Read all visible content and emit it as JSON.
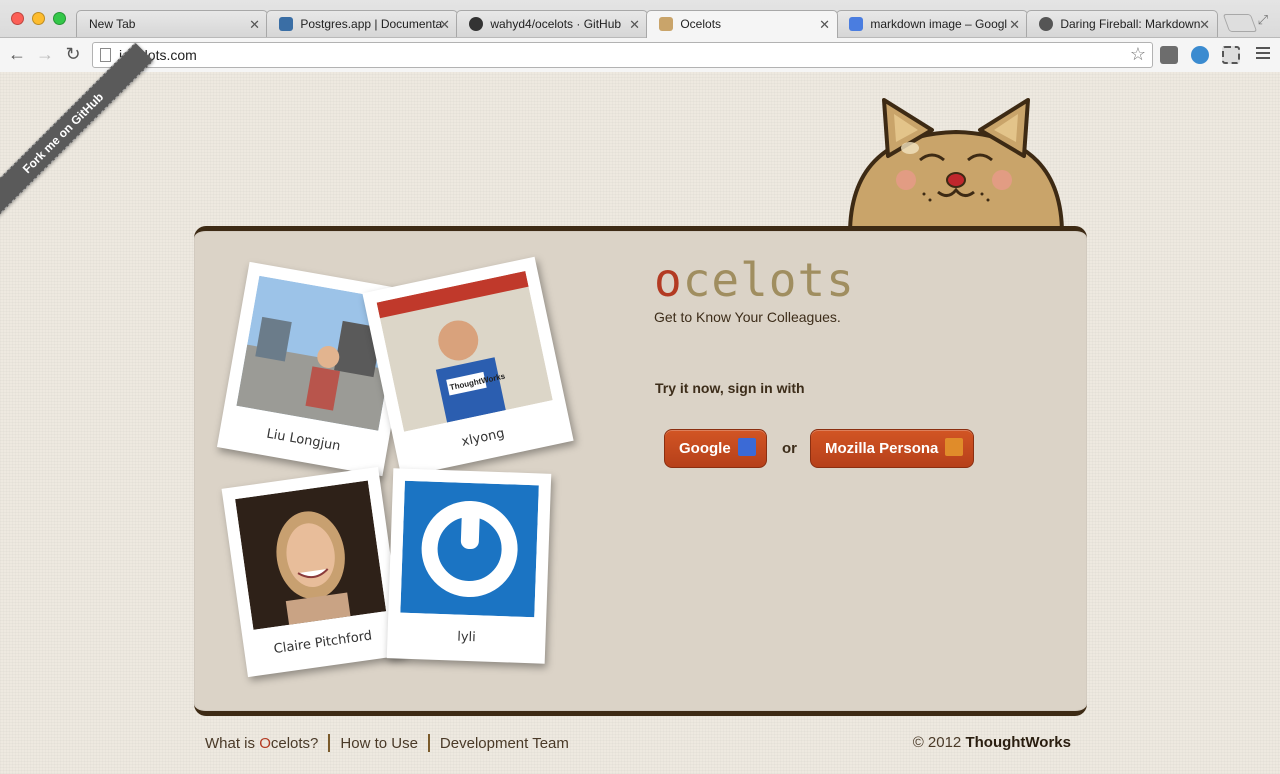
{
  "browser": {
    "tabs": [
      {
        "label": "New Tab",
        "active": false
      },
      {
        "label": "Postgres.app | Documenta",
        "active": false
      },
      {
        "label": "wahyd4/ocelots · GitHub",
        "active": false
      },
      {
        "label": "Ocelots",
        "active": true
      },
      {
        "label": "markdown image – Googl",
        "active": false
      },
      {
        "label": "Daring Fireball: Markdown",
        "active": false
      }
    ],
    "url": "iocelots.com"
  },
  "page": {
    "ribbon": "Fork me on GitHub",
    "logo_first": "o",
    "logo_rest": "celots",
    "tagline": "Get to Know Your Colleagues.",
    "signin_prompt": "Try it now, sign in with",
    "google_button": "Google",
    "or_text": "or",
    "persona_button": "Mozilla Persona",
    "polaroids": [
      {
        "name": "Liu Longjun"
      },
      {
        "name": "xlyong"
      },
      {
        "name": "Claire Pitchford"
      },
      {
        "name": "lyli"
      }
    ],
    "shirt_text": "ThoughtWorks"
  },
  "footer": {
    "link_1_prefix": "What is ",
    "link_1_o": "O",
    "link_1_suffix": "celots?",
    "link_2": "How to Use",
    "link_3": "Development Team",
    "copyright_prefix": "© 2012 ",
    "copyright_brand": "ThoughtWorks"
  },
  "colors": {
    "accent": "#b33a22",
    "button": "#c44b1f",
    "panel": "#dbd3c7",
    "border": "#3d2a14",
    "logo_gold": "#a08e60"
  }
}
